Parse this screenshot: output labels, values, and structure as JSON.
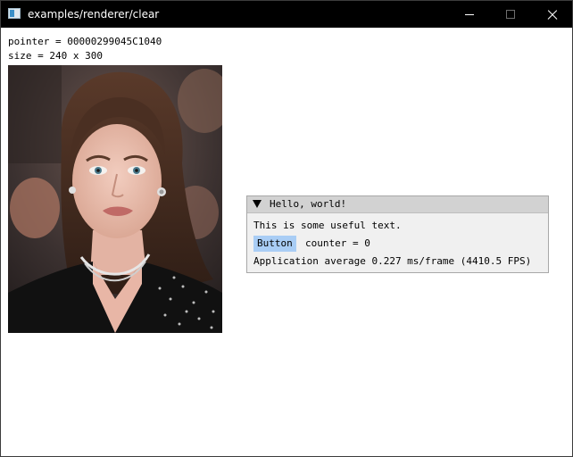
{
  "window": {
    "title": "examples/renderer/clear",
    "icons": {
      "app": "app-window-icon",
      "minimize": "minimize-icon",
      "maximize": "maximize-icon",
      "close": "close-icon"
    }
  },
  "info": {
    "pointer": "pointer = 00000299045C1040",
    "size": "size = 240 x 300"
  },
  "imgui": {
    "title": "Hello, world!",
    "text": "This is some useful text.",
    "button_label": "Button",
    "counter": "counter = 0",
    "fps": "Application average 0.227 ms/frame (4410.5 FPS)"
  },
  "colors": {
    "titlebar": "#000000",
    "imgui_bg": "#f0f0f0",
    "imgui_title_bg": "#d2d2d2",
    "button": "#a9cdf5"
  }
}
